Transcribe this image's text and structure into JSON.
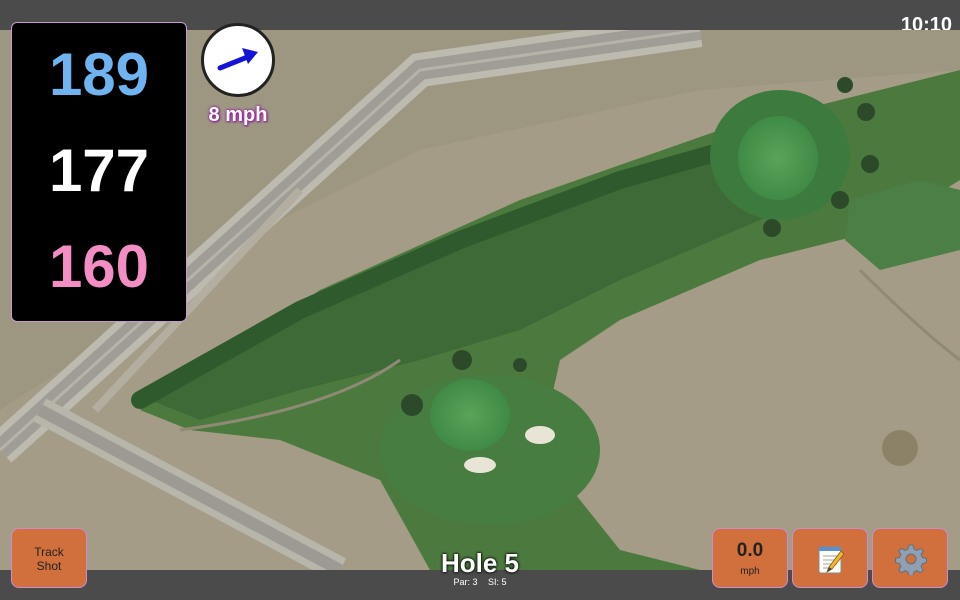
{
  "status_bar": {
    "time": "10:10"
  },
  "distances": {
    "back": "189",
    "middle": "177",
    "front": "160"
  },
  "wind": {
    "speed_label": "8 mph",
    "direction_icon": "arrow-icon"
  },
  "hole": {
    "title": "Hole 5",
    "par_label": "Par: 3",
    "si_label": "SI: 5"
  },
  "buttons": {
    "track_shot_line1": "Track",
    "track_shot_line2": "Shot",
    "speed_value": "0.0",
    "speed_unit": "mph",
    "notes_icon": "notepad-icon",
    "settings_icon": "gear-icon"
  },
  "colors": {
    "back_distance": "#6fb4f0",
    "middle_distance": "#ffffff",
    "front_distance": "#f38ec4",
    "button_orange": "#d1703d"
  }
}
